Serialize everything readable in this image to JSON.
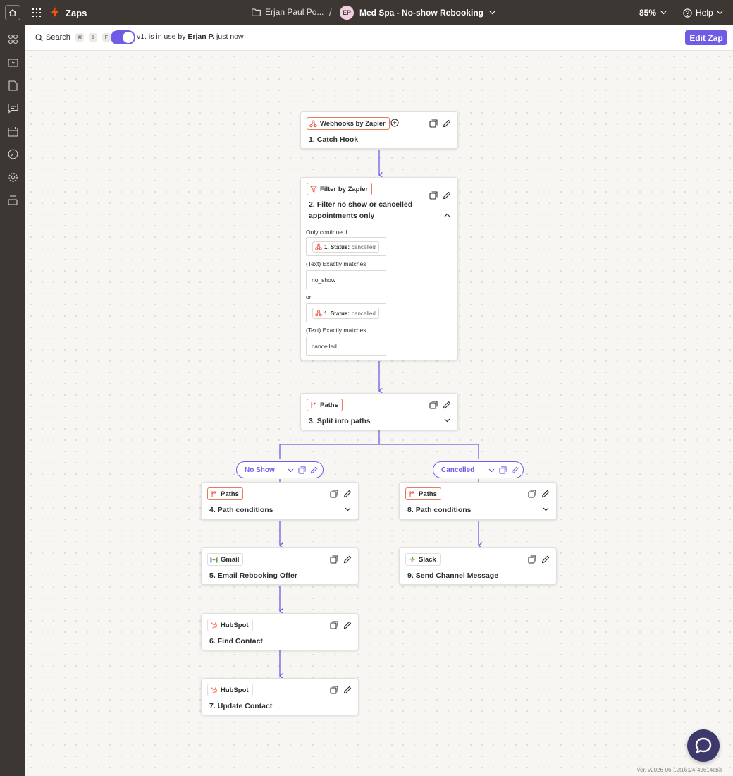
{
  "colors": {
    "brand_purple": "#6e5ce6",
    "chrome": "#3d3734",
    "zapier_orange": "#ff4f00",
    "chip_border": "#e8795d"
  },
  "header": {
    "app_name": "Zaps",
    "folder": "Erjan Paul Po...",
    "separator": "/",
    "avatar_initials": "EP",
    "zap_title": "Med Spa - No-show Rebooking",
    "zoom": "85%",
    "help": "Help"
  },
  "toolbar": {
    "search_label": "Search",
    "shortcut_keys": [
      "⌘",
      "⇧",
      "F"
    ],
    "toggle_on": true,
    "version_link": "v1.",
    "status_mid": " is in use by ",
    "user": "Erjan P.",
    "status_time": " just now",
    "edit_button": "Edit Zap"
  },
  "steps": {
    "s1": {
      "app": "Webhooks by Zapier",
      "num": "1.",
      "title": "Catch Hook"
    },
    "s2": {
      "app": "Filter by Zapier",
      "num": "2.",
      "title": "Filter no show or cancelled appointments only"
    },
    "s3": {
      "app": "Paths",
      "num": "3.",
      "title": "Split into paths"
    },
    "s4": {
      "app": "Paths",
      "num": "4.",
      "title": "Path conditions"
    },
    "s5": {
      "app": "Gmail",
      "num": "5.",
      "title": "Email Rebooking Offer"
    },
    "s6": {
      "app": "HubSpot",
      "num": "6.",
      "title": "Find Contact"
    },
    "s7": {
      "app": "HubSpot",
      "num": "7.",
      "title": "Update Contact"
    },
    "s8": {
      "app": "Paths",
      "num": "8.",
      "title": "Path conditions"
    },
    "s9": {
      "app": "Slack",
      "num": "9.",
      "title": "Send Channel Message"
    }
  },
  "filter": {
    "intro": "Only continue if",
    "or_label": "or",
    "conditions": [
      {
        "field_label": "1. Status:",
        "field_value": "cancelled",
        "operator": "(Text) Exactly matches",
        "value": "no_show"
      },
      {
        "field_label": "1. Status:",
        "field_value": "cancelled",
        "operator": "(Text) Exactly matches",
        "value": "cancelled"
      }
    ]
  },
  "paths": {
    "left": "No Show",
    "right": "Cancelled"
  },
  "footer": {
    "version": "ver. v2026-06-12t16:24-49614cb3"
  },
  "icons": [
    "home-icon",
    "grid-icon",
    "bolt-icon",
    "folder-icon",
    "chevron-down-icon",
    "help-icon",
    "apps-icon",
    "zap-icon",
    "document-icon",
    "chat-bubble-icon",
    "calendar-icon",
    "history-icon",
    "settings-icon",
    "stack-icon",
    "assistant-icon",
    "search-icon",
    "copy-icon",
    "pencil-icon",
    "add-icon",
    "webhook-icon",
    "filter-icon",
    "paths-icon",
    "gmail-icon",
    "hubspot-icon",
    "slack-icon",
    "chevron-up-icon",
    "chat-icon"
  ]
}
